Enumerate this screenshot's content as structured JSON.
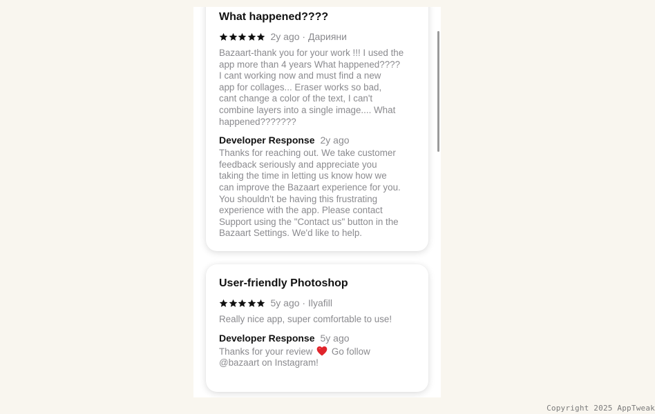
{
  "reviews": [
    {
      "title": "What happened????",
      "rating": 5,
      "meta": "2y ago · Дарияни",
      "body": "Bazaart-thank you for your work !!! I used the\napp more than 4 years What happened????\nI cant working now and must find a new\napp for collages... Eraser works so bad,\ncant change a color of the text, I can't\ncombine layers into a single image.... What\nhappened???????",
      "dev_label": "Developer Response",
      "dev_time": "2y ago",
      "dev_body": "Thanks for reaching out. We take customer\nfeedback seriously and appreciate you\ntaking the time in letting us know how we\ncan improve the Bazaart experience for you.\nYou shouldn't be having this frustrating\nexperience with the app. Please contact\nSupport using the \"Contact us\" button in the\nBazaart Settings. We'd like to help."
    },
    {
      "title": "User-friendly Photoshop",
      "rating": 5,
      "meta": "5y ago · Ilyafill",
      "body": "Really nice app, super comfortable to use!",
      "dev_label": "Developer Response",
      "dev_time": "5y ago",
      "dev_body_before": "Thanks for your review",
      "dev_body_emoji": "red-heart-icon",
      "dev_body_after": "Go follow\n@bazaart on Instagram!"
    }
  ],
  "colors": {
    "heart": "#e0242b",
    "star": "#111111",
    "muted_text": "#8a8a8e"
  },
  "footer": {
    "copyright": "Copyright 2025 AppTweak"
  }
}
